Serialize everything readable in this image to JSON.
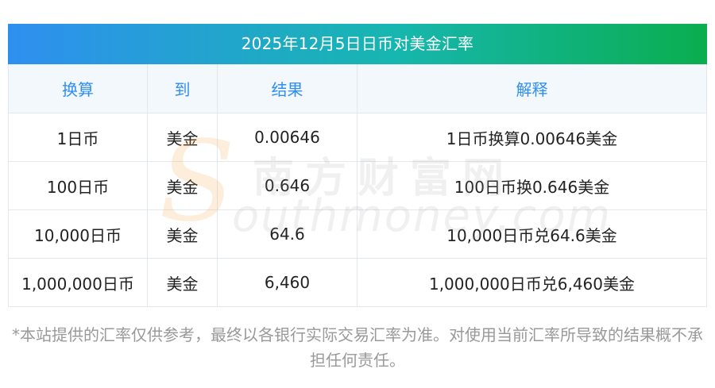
{
  "title": "2025年12月5日日币对美金汇率",
  "table": {
    "headers": [
      "换算",
      "到",
      "结果",
      "解释"
    ],
    "rows": [
      [
        "1日币",
        "美金",
        "0.00646",
        "1日币换算0.00646美金"
      ],
      [
        "100日币",
        "美金",
        "0.646",
        "100日币换0.646美金"
      ],
      [
        "10,000日币",
        "美金",
        "64.6",
        "10,000日币兑64.6美金"
      ],
      [
        "1,000,000日币",
        "美金",
        "6,460",
        "1,000,000日币兑6,460美金"
      ]
    ]
  },
  "watermark": {
    "mark": "S",
    "chinese": "南方财富网",
    "english": "outhmoney.com"
  },
  "disclaimer": "*本站提供的汇率仅供参考，最终以各银行实际交易汇率为准。对使用当前汇率所导致的结果概不承担任何责任。",
  "colors": {
    "header_text": "#2f8ff0",
    "title_gradient_start": "#2f8ff0",
    "title_gradient_end": "#0aae4e",
    "header_bg": "#f3f8fd"
  }
}
